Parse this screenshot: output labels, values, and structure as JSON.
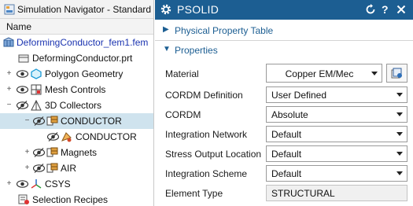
{
  "navigator": {
    "title": "Simulation Navigator - Standard",
    "column_header": "Name",
    "tree": {
      "root": "DeformingConductor_fem1.fem",
      "prt": "DeformingConductor.prt",
      "polygon": "Polygon Geometry",
      "mesh": "Mesh Controls",
      "collectors": "3D Collectors",
      "conductor": "CONDUCTOR",
      "conductor_mesh": "CONDUCTOR",
      "magnets": "Magnets",
      "air": "AIR",
      "csys": "CSYS",
      "recipes": "Selection Recipes"
    }
  },
  "dialog": {
    "title": "PSOLID",
    "sections": {
      "physical_property_table": "Physical Property Table",
      "properties": "Properties"
    },
    "fields": {
      "material_label": "Material",
      "material_value": "Copper EM/Mec",
      "cordm_definition_label": "CORDM Definition",
      "cordm_definition_value": "User Defined",
      "cordm_label": "CORDM",
      "cordm_value": "Absolute",
      "integration_network_label": "Integration Network",
      "integration_network_value": "Default",
      "stress_output_label": "Stress Output Location",
      "stress_output_value": "Default",
      "integration_scheme_label": "Integration Scheme",
      "integration_scheme_value": "Default",
      "element_type_label": "Element Type",
      "element_type_value": "STRUCTURAL"
    }
  },
  "colors": {
    "dialog_header": "#1c5e92",
    "section_text": "#1c5e92",
    "selected_row": "#cfe3ee",
    "link_text": "#1a33b0"
  }
}
